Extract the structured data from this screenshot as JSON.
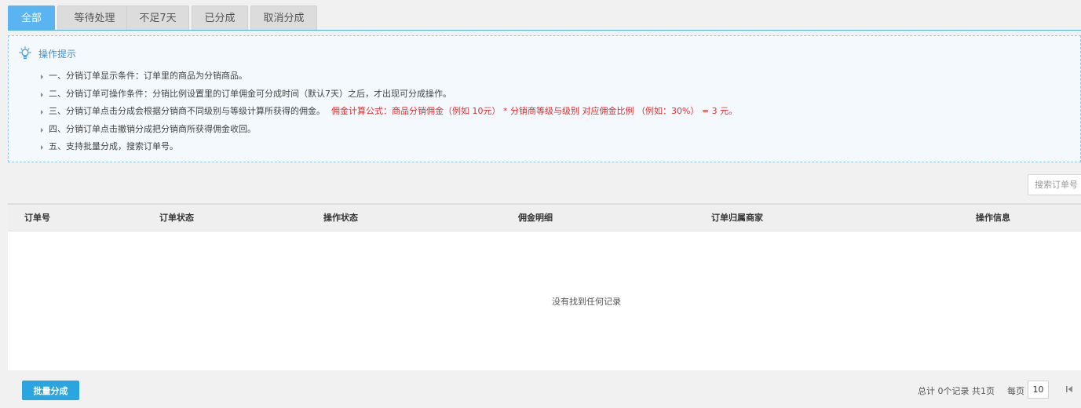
{
  "tabs": [
    {
      "label": "全部",
      "active": true
    },
    {
      "label": "等待处理",
      "active": false
    },
    {
      "label": "不足7天",
      "active": false
    },
    {
      "label": "已分成",
      "active": false
    },
    {
      "label": "取消分成",
      "active": false
    }
  ],
  "tips": {
    "title": "操作提示",
    "items": [
      "一、分销订单显示条件：订单里的商品为分销商品。",
      "二、分销订单可操作条件：分销比例设置里的订单佣金可分成时间（默认7天）之后，才出现可分成操作。",
      "三、分销订单点击分成会根据分销商不同级别与等级计算所获得的佣金。",
      "四、分销订单点击撤销分成把分销商所获得佣金收回。",
      "五、支持批量分成，搜索订单号。"
    ],
    "formula": "佣金计算公式：商品分销佣金（例如 10元） * 分销商等级与级别 对应佣金比例 （例如：30%） = 3 元。"
  },
  "search": {
    "placeholder": "搜索订单号"
  },
  "table": {
    "columns": [
      "订单号",
      "订单状态",
      "操作状态",
      "佣金明细",
      "订单归属商家",
      "操作信息"
    ],
    "empty_text": "没有找到任何记录"
  },
  "footer": {
    "batch_label": "批量分成",
    "total_text": "总计 0个记录 共1页",
    "per_page_label": "每页",
    "per_page_value": "10"
  },
  "colors": {
    "accent": "#5ab4f1",
    "button": "#2aa5df",
    "formula": "#e62b2b"
  }
}
